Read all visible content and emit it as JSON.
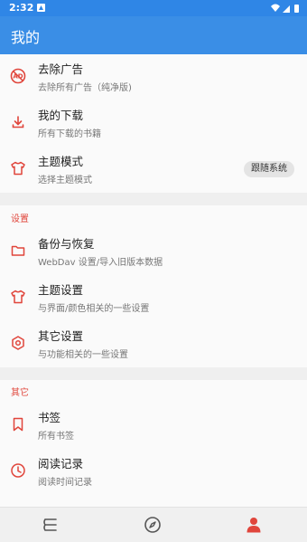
{
  "status_bar": {
    "time": "2:32"
  },
  "app_bar": {
    "title": "我的"
  },
  "top_items": [
    {
      "title": "去除广告",
      "subtitle": "去除所有广告（纯净版)"
    },
    {
      "title": "我的下载",
      "subtitle": "所有下载的书籍"
    },
    {
      "title": "主题模式",
      "subtitle": "选择主题模式",
      "chip": "跟随系统"
    }
  ],
  "settings_section": {
    "header": "设置",
    "items": [
      {
        "title": "备份与恢复",
        "subtitle": "WebDav 设置/导入旧版本数据"
      },
      {
        "title": "主题设置",
        "subtitle": "与界面/颜色相关的一些设置"
      },
      {
        "title": "其它设置",
        "subtitle": "与功能相关的一些设置"
      }
    ]
  },
  "other_section": {
    "header": "其它",
    "items": [
      {
        "title": "书签",
        "subtitle": "所有书签"
      },
      {
        "title": "阅读记录",
        "subtitle": "阅读时间记录"
      }
    ]
  },
  "colors": {
    "accent": "#e0453b",
    "app_bar": "#3a8ee6",
    "status_bar": "#2f86e6"
  },
  "icons": {
    "remove_ads": "ad-block-icon",
    "downloads": "download-icon",
    "theme_mode": "tshirt-icon",
    "backup": "folder-icon",
    "theme_settings": "tshirt-icon",
    "other_settings": "gear-icon",
    "bookmarks": "bookmark-icon",
    "reading_history": "clock-icon"
  },
  "bottom_nav": [
    "bookshelf-icon",
    "explore-icon",
    "profile-icon"
  ]
}
